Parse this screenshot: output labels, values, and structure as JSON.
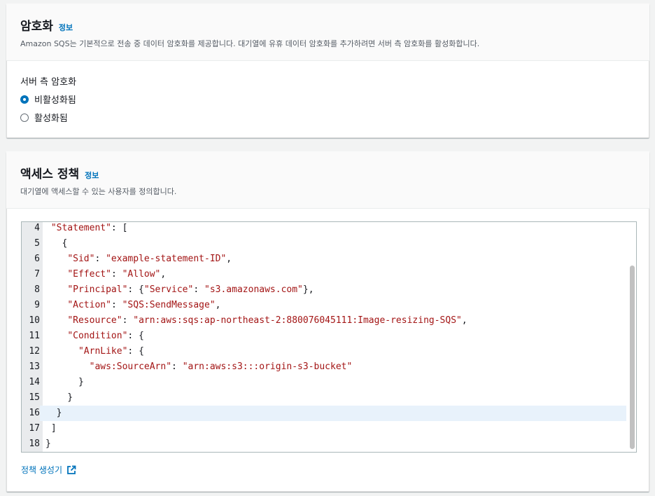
{
  "encryption": {
    "title": "암호화",
    "info": "정보",
    "description": "Amazon SQS는 기본적으로 전송 중 데이터 암호화를 제공합니다. 대기열에 유휴 데이터 암호화를 추가하려면 서버 측 암호화를 활성화합니다.",
    "field_label": "서버 측 암호화",
    "options": [
      {
        "label": "비활성화됨",
        "selected": true
      },
      {
        "label": "활성화됨",
        "selected": false
      }
    ]
  },
  "access_policy": {
    "title": "액세스 정책",
    "info": "정보",
    "description": "대기열에 액세스할 수 있는 사용자를 정의합니다.",
    "code_lines": [
      {
        "n": "4",
        "text": " \"Statement\": ["
      },
      {
        "n": "5",
        "text": "   {"
      },
      {
        "n": "6",
        "text": "    \"Sid\": \"example-statement-ID\","
      },
      {
        "n": "7",
        "text": "    \"Effect\": \"Allow\","
      },
      {
        "n": "8",
        "text": "    \"Principal\": {\"Service\": \"s3.amazonaws.com\"},"
      },
      {
        "n": "9",
        "text": "    \"Action\": \"SQS:SendMessage\","
      },
      {
        "n": "10",
        "text": "    \"Resource\": \"arn:aws:sqs:ap-northeast-2:880076045111:Image-resizing-SQS\","
      },
      {
        "n": "11",
        "text": "    \"Condition\": {"
      },
      {
        "n": "12",
        "text": "      \"ArnLike\": {"
      },
      {
        "n": "13",
        "text": "        \"aws:SourceArn\": \"arn:aws:s3:::origin-s3-bucket\""
      },
      {
        "n": "14",
        "text": "      }"
      },
      {
        "n": "15",
        "text": "    }"
      },
      {
        "n": "16",
        "text": "  }"
      },
      {
        "n": "17",
        "text": " ]"
      },
      {
        "n": "18",
        "text": "}"
      }
    ],
    "active_line": "16",
    "generator_link": "정책 생성기",
    "generator_icon": "external-link-icon"
  },
  "colors": {
    "accent": "#0073bb",
    "string": "#a31515",
    "gutter": "#e9ebed",
    "active_line": "#e8f2fb"
  }
}
